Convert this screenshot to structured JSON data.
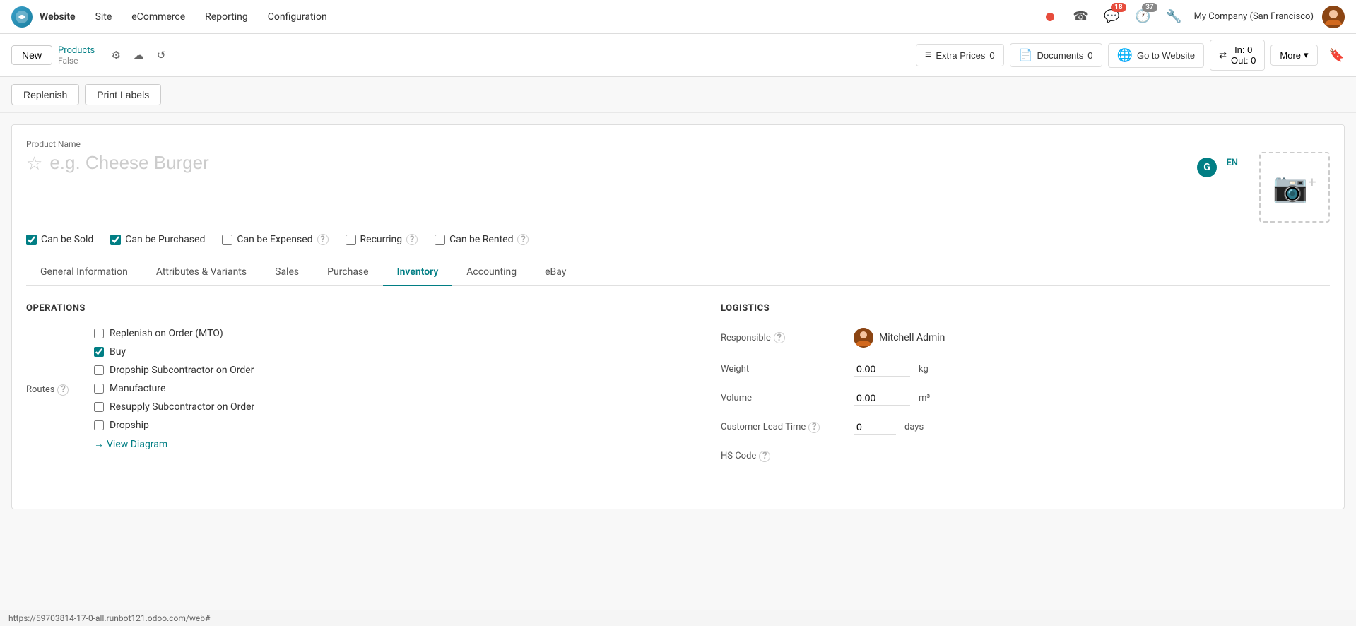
{
  "nav": {
    "logo_text": "O",
    "app_name": "Website",
    "items": [
      {
        "label": "Site",
        "id": "site"
      },
      {
        "label": "eCommerce",
        "id": "ecommerce"
      },
      {
        "label": "Reporting",
        "id": "reporting"
      },
      {
        "label": "Configuration",
        "id": "configuration"
      }
    ],
    "notifications": {
      "chat_count": "18",
      "clock_count": "37"
    },
    "company": "My Company (San Francisco)"
  },
  "toolbar": {
    "new_label": "New",
    "breadcrumb_parent": "Products",
    "breadcrumb_current": "False",
    "extra_prices_label": "Extra Prices",
    "extra_prices_count": "0",
    "documents_label": "Documents",
    "documents_count": "0",
    "go_to_website_label": "Go to Website",
    "in_out_label_in": "In: 0",
    "in_out_label_out": "Out: 0",
    "more_label": "More"
  },
  "actions": {
    "replenish_label": "Replenish",
    "print_labels_label": "Print Labels"
  },
  "product": {
    "name_label": "Product Name",
    "name_placeholder": "e.g. Cheese Burger",
    "checkboxes": [
      {
        "label": "Can be Sold",
        "checked": true,
        "has_help": false,
        "id": "can_be_sold"
      },
      {
        "label": "Can be Purchased",
        "checked": true,
        "has_help": false,
        "id": "can_be_purchased"
      },
      {
        "label": "Can be Expensed",
        "checked": false,
        "has_help": true,
        "id": "can_be_expensed"
      },
      {
        "label": "Recurring",
        "checked": false,
        "has_help": true,
        "id": "recurring"
      },
      {
        "label": "Can be Rented",
        "checked": false,
        "has_help": true,
        "id": "can_be_rented"
      }
    ]
  },
  "tabs": [
    {
      "label": "General Information",
      "id": "general_information",
      "active": false
    },
    {
      "label": "Attributes & Variants",
      "id": "attributes_variants",
      "active": false
    },
    {
      "label": "Sales",
      "id": "sales",
      "active": false
    },
    {
      "label": "Purchase",
      "id": "purchase",
      "active": false
    },
    {
      "label": "Inventory",
      "id": "inventory",
      "active": true
    },
    {
      "label": "Accounting",
      "id": "accounting",
      "active": false
    },
    {
      "label": "eBay",
      "id": "ebay",
      "active": false
    }
  ],
  "inventory_tab": {
    "operations": {
      "title": "OPERATIONS",
      "routes_label": "Routes",
      "routes_help": true,
      "routes": [
        {
          "label": "Replenish on Order (MTO)",
          "checked": false,
          "id": "mto"
        },
        {
          "label": "Buy",
          "checked": true,
          "id": "buy"
        },
        {
          "label": "Dropship Subcontractor on Order",
          "checked": false,
          "id": "dropship_sub"
        },
        {
          "label": "Manufacture",
          "checked": false,
          "id": "manufacture"
        },
        {
          "label": "Resupply Subcontractor on Order",
          "checked": false,
          "id": "resupply_sub"
        },
        {
          "label": "Dropship",
          "checked": false,
          "id": "dropship"
        }
      ],
      "view_diagram_label": "View Diagram"
    },
    "logistics": {
      "title": "LOGISTICS",
      "fields": [
        {
          "label": "Responsible",
          "has_help": true,
          "id": "responsible",
          "value": "Mitchell Admin",
          "has_avatar": true
        },
        {
          "label": "Weight",
          "has_help": false,
          "id": "weight",
          "value": "0.00",
          "unit": "kg"
        },
        {
          "label": "Volume",
          "has_help": false,
          "id": "volume",
          "value": "0.00",
          "unit": "m³"
        },
        {
          "label": "Customer Lead Time",
          "has_help": true,
          "id": "customer_lead_time",
          "value": "0",
          "unit": "days"
        },
        {
          "label": "HS Code",
          "has_help": true,
          "id": "hs_code",
          "value": ""
        }
      ]
    }
  },
  "status_bar": {
    "url": "https://59703814-17-0-all.runbot121.odoo.com/web#"
  }
}
